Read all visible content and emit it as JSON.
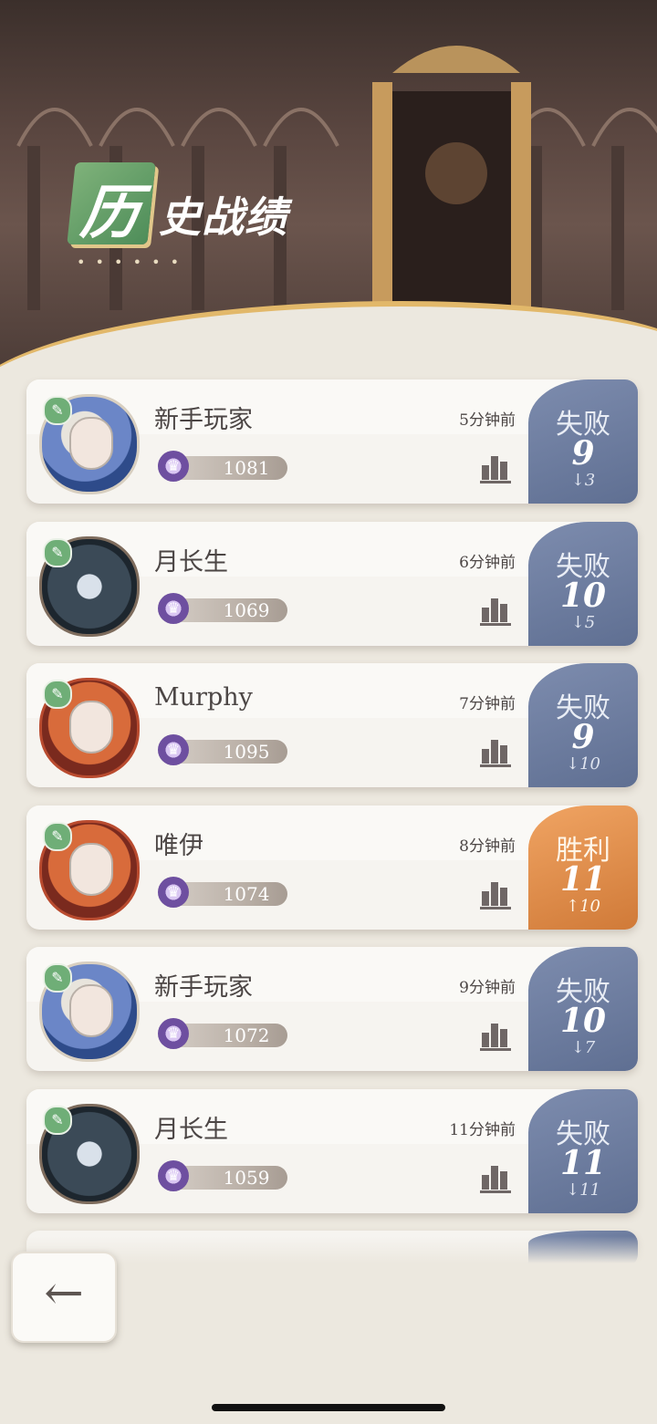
{
  "header": {
    "title_first_char": "历",
    "title_rest": "史战绩",
    "title_dots": "• • • • • •"
  },
  "matches": [
    {
      "name": "新手玩家",
      "time": "5分钟前",
      "score": "1081",
      "result_label": "失败",
      "rank": "9",
      "change": "↓3",
      "outcome": "lose"
    },
    {
      "name": "月长生",
      "time": "6分钟前",
      "score": "1069",
      "result_label": "失败",
      "rank": "10",
      "change": "↓5",
      "outcome": "lose"
    },
    {
      "name": "Murphy",
      "time": "7分钟前",
      "score": "1095",
      "result_label": "失败",
      "rank": "9",
      "change": "↓10",
      "outcome": "lose"
    },
    {
      "name": "唯伊",
      "time": "8分钟前",
      "score": "1074",
      "result_label": "胜利",
      "rank": "11",
      "change": "↑10",
      "outcome": "win"
    },
    {
      "name": "新手玩家",
      "time": "9分钟前",
      "score": "1072",
      "result_label": "失败",
      "rank": "10",
      "change": "↓7",
      "outcome": "lose"
    },
    {
      "name": "月长生",
      "time": "11分钟前",
      "score": "1059",
      "result_label": "失败",
      "rank": "11",
      "change": "↓11",
      "outcome": "lose"
    }
  ],
  "back_button": {
    "glyph": "←"
  },
  "colors": {
    "lose": "#6f7fa3",
    "win": "#e08e4a",
    "badge_green": "#6fae77",
    "background": "#ece8df"
  }
}
